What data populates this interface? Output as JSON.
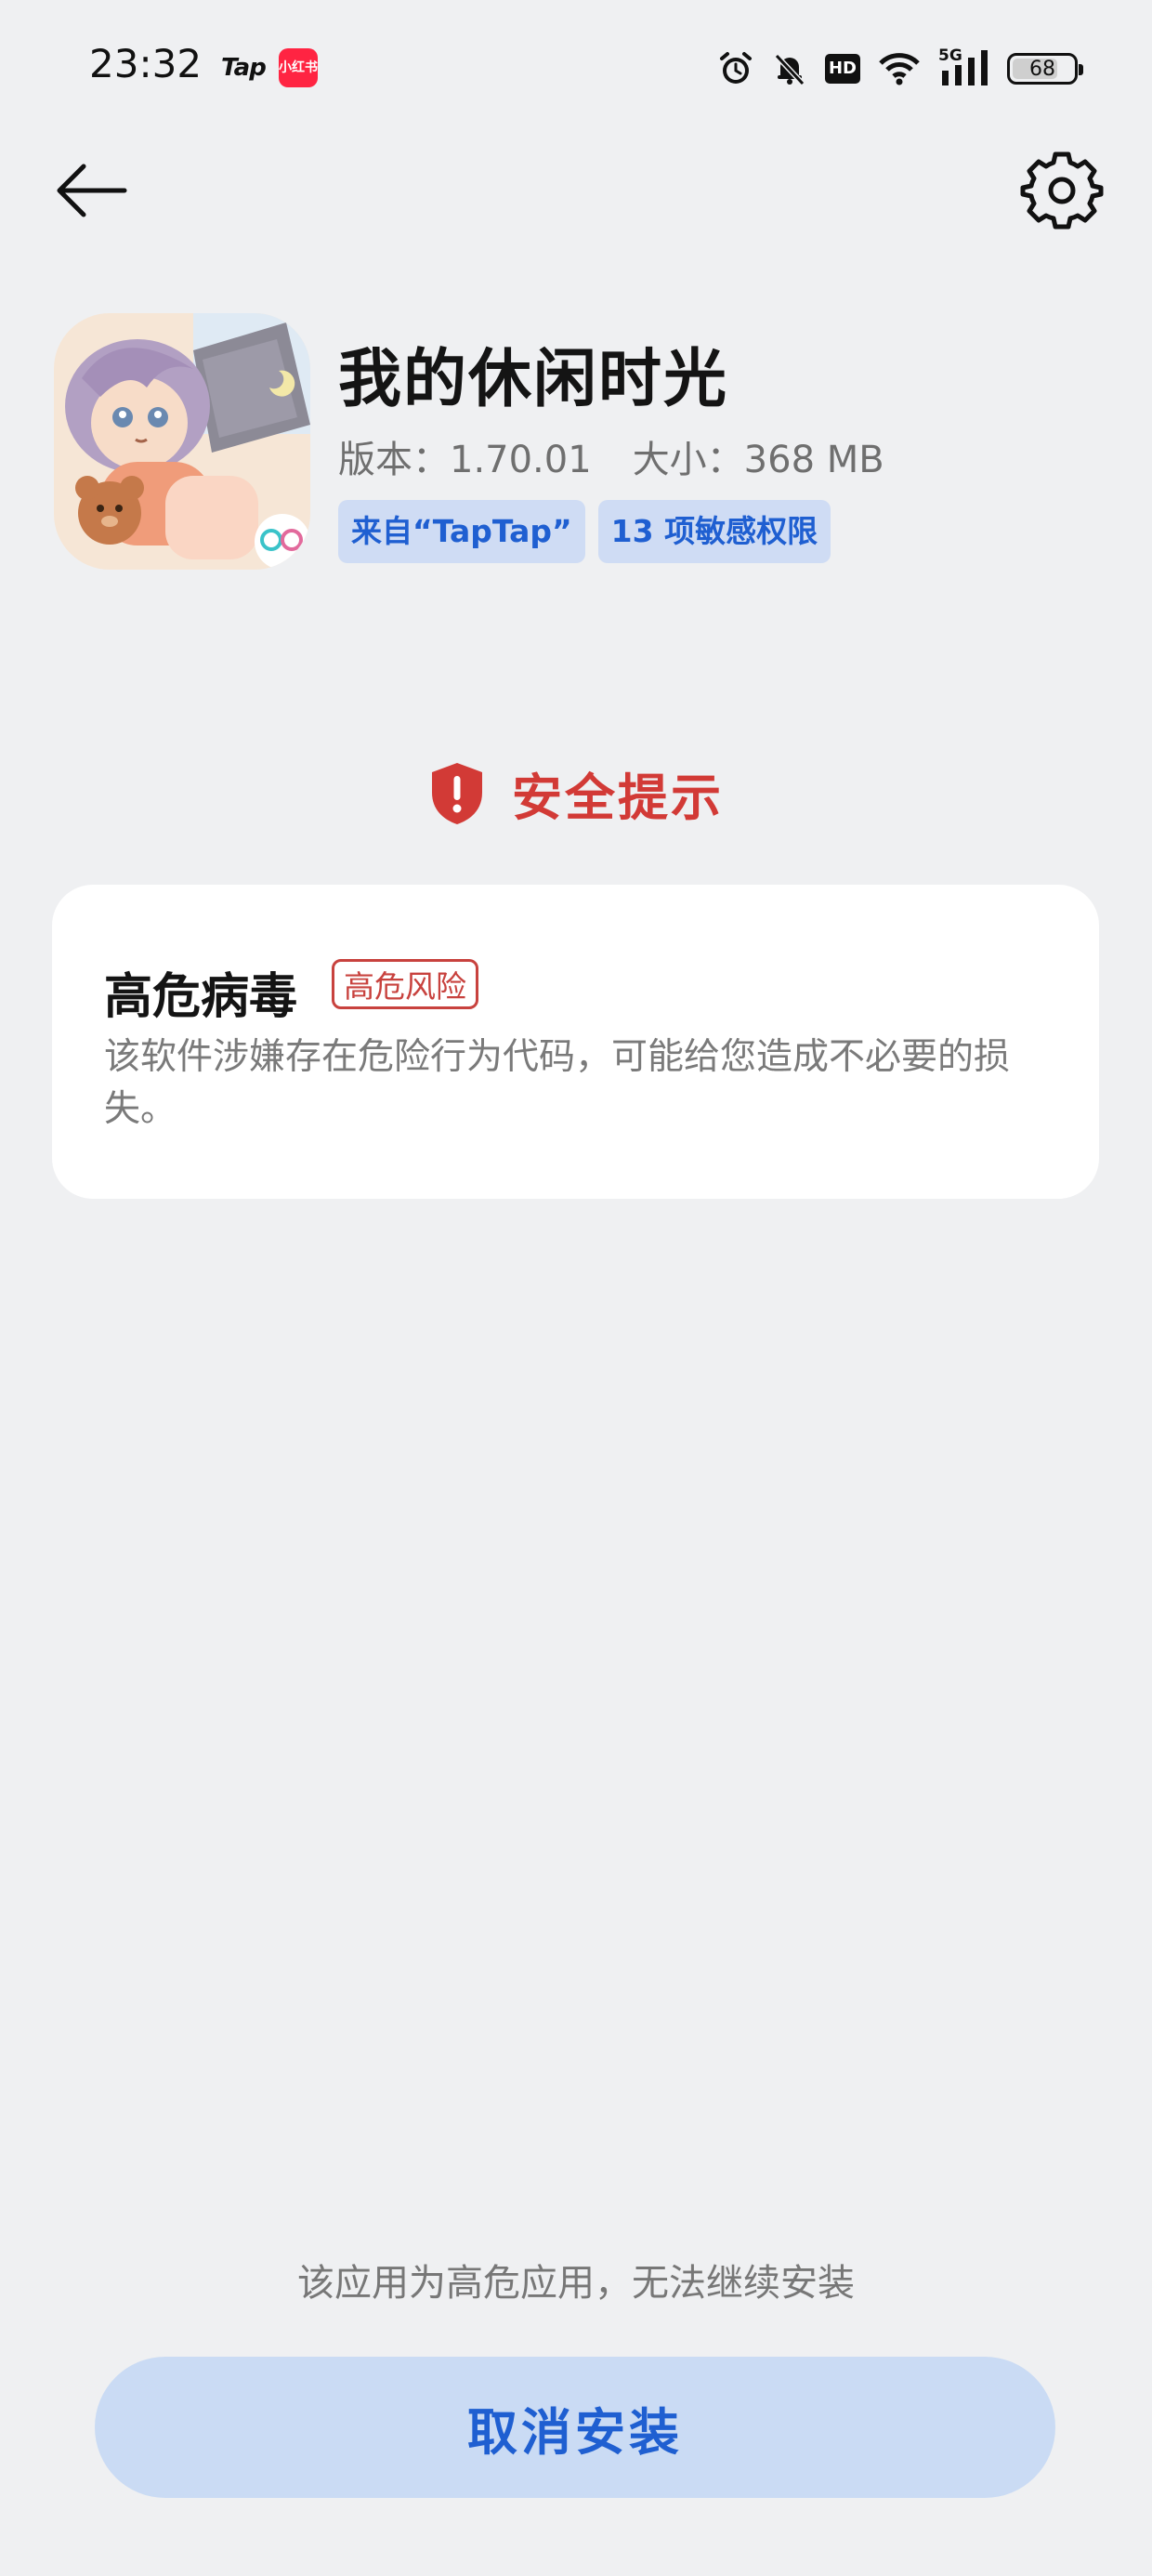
{
  "status_bar": {
    "time": "23:32",
    "left_app_icons": [
      "Tap",
      "小红书"
    ],
    "battery": "68",
    "network": "5G",
    "hd": "HD"
  },
  "nav": {
    "back_icon": "arrow-left-icon",
    "settings_icon": "gear-icon"
  },
  "app": {
    "name": "我的休闲时光",
    "version_label": "版本：1.70.01",
    "size_label": "大小：368 MB",
    "source_chip": "来自“TapTap”",
    "permissions_chip": "13 项敏感权限"
  },
  "security": {
    "title": "安全提示",
    "icon": "shield-alert-icon",
    "accent_color": "#d23a36"
  },
  "risk": {
    "name": "高危病毒",
    "badge": "高危风险",
    "description": "该软件涉嫌存在危险行为代码，可能给您造成不必要的损失。"
  },
  "footer": {
    "note": "该应用为高危应用，无法继续安装",
    "cancel_button": "取消安装",
    "button_color": "#cadbf4",
    "button_text_color": "#1f5fd1"
  }
}
